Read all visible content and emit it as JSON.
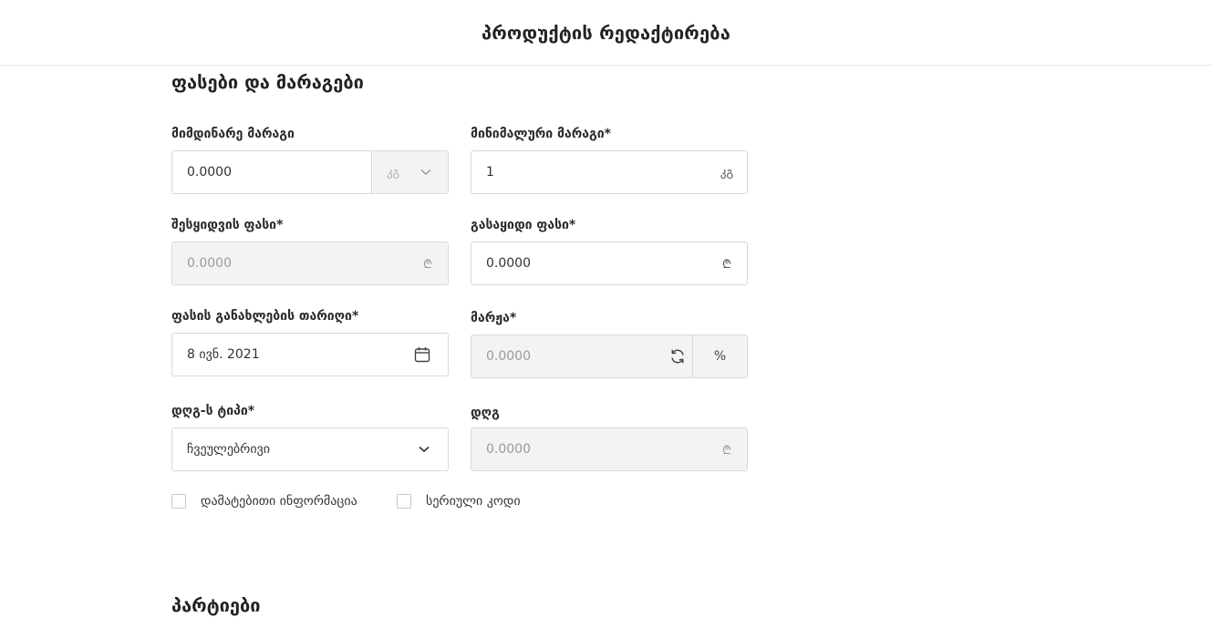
{
  "header": {
    "title": "პროდუქტის რედაქტირება"
  },
  "section_prices": {
    "title": "ფასები და მარაგები"
  },
  "current_stock": {
    "label": "მიმდინარე მარაგი",
    "value": "0.0000",
    "unit": "კგ"
  },
  "min_stock": {
    "label": "მინიმალური მარაგი*",
    "value": "1",
    "unit": "კგ"
  },
  "purchase_price": {
    "label": "შესყიდვის ფასი*",
    "value": "0.0000",
    "currency": "₾"
  },
  "sale_price": {
    "label": "გასაყიდი ფასი*",
    "value": "0.0000",
    "currency": "₾"
  },
  "price_update_date": {
    "label": "ფასის განახლების თარიღი*",
    "value": "8 ივნ. 2021"
  },
  "margin": {
    "label": "მარჟა*",
    "value": "0.0000",
    "unit": "%"
  },
  "vat_type": {
    "label": "დღგ-ს ტიპი*",
    "value": "ჩვეულებრივი"
  },
  "vat": {
    "label": "დღგ",
    "value": "0.0000",
    "currency": "₾"
  },
  "checkboxes": {
    "additional_info": "დამატებითი ინფორმაცია",
    "serial_code": "სერიული კოდი"
  },
  "section_batches": {
    "title": "პარტიები"
  }
}
